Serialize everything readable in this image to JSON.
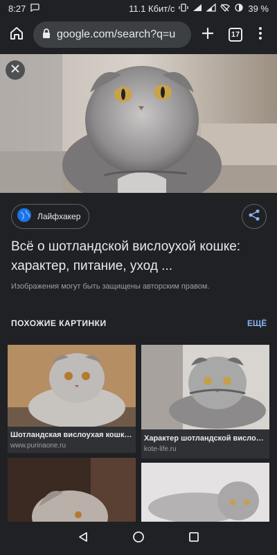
{
  "status": {
    "time": "8:27",
    "speed": "11.1 Кбит/с",
    "battery": "39 %"
  },
  "toolbar": {
    "url": "google.com/search?q=u",
    "tabs_count": "17"
  },
  "result": {
    "source": "Лайфхакер",
    "title": "Всё о шотландской вислоухой кошке: характер, питание, уход ...",
    "copyright": "Изображения могут быть защищены авторским правом."
  },
  "similar": {
    "header": "ПОХОЖИЕ КАРТИНКИ",
    "more": "ЕЩЁ",
    "cards": [
      {
        "caption": "Шотландская вислоухая кошка: ...",
        "domain": "www.purinaone.ru"
      },
      {
        "caption": "Характер шотландской вислоух...",
        "domain": "kote-life.ru"
      }
    ]
  },
  "icons": {
    "home": "home-icon",
    "lock": "lock-icon",
    "plus": "plus-icon",
    "menu": "more-vert-icon",
    "close": "close-icon",
    "share": "share-icon",
    "globe": "globe-icon",
    "back": "back-icon",
    "homenav": "circle-home-icon",
    "recents": "recents-icon"
  },
  "colors": {
    "background": "#202124",
    "accent": "#8ab4f8",
    "text": "#e8eaed",
    "muted": "#9aa0a6"
  }
}
